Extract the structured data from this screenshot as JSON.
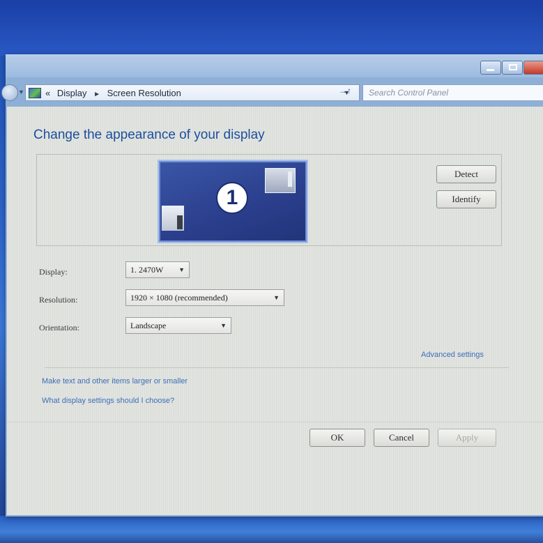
{
  "window": {
    "address": {
      "overflow": "«",
      "crumb1": "Display",
      "separator": "►",
      "crumb2": "Screen Resolution",
      "dropdown": "▼",
      "refresh": "➔"
    },
    "search": {
      "placeholder": "Search Control Panel"
    },
    "controls": [
      "minimize",
      "maximize",
      "close"
    ]
  },
  "main": {
    "title": "Change the appearance of your display",
    "monitor_number": "1",
    "detect_label": "Detect",
    "identify_label": "Identify",
    "fields": {
      "display": {
        "label": "Display:",
        "value": "1. 2470W"
      },
      "resolution": {
        "label": "Resolution:",
        "value": "1920 × 1080 (recommended)"
      },
      "orientation": {
        "label": "Orientation:",
        "value": "Landscape"
      }
    },
    "advanced_link": "Advanced settings",
    "links": [
      "Make text and other items larger or smaller",
      "What display settings should I choose?"
    ],
    "buttons": {
      "ok": "OK",
      "cancel": "Cancel",
      "apply": "Apply"
    }
  },
  "icons": {
    "caret": "▼",
    "nav_back": "back-arrow-icon",
    "address_icon": "control-panel-icon"
  },
  "colors": {
    "title": "#1d4e9e",
    "link": "#3d6eb8",
    "desktop": "#2d63c9"
  }
}
